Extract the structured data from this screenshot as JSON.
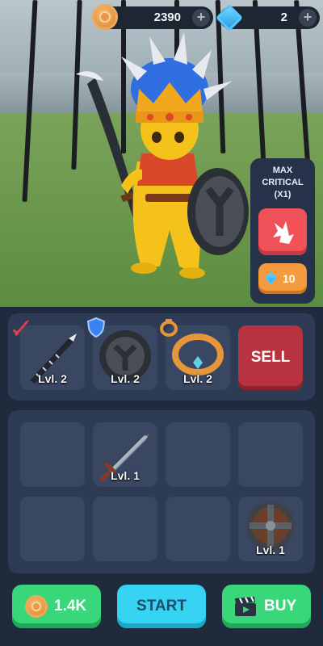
{
  "currency": {
    "coins": "2390",
    "gems": "2",
    "plus": "+"
  },
  "crit_panel": {
    "line1": "MAX",
    "line2": "CRITICAL",
    "line3": "(X1)",
    "cost": "10"
  },
  "equipment": {
    "weapon": {
      "level": "Lvl. 2"
    },
    "shield": {
      "level": "Lvl. 2"
    },
    "ring": {
      "level": "Lvl. 2"
    },
    "sell_label": "SELL"
  },
  "inventory": [
    {
      "slot": 1,
      "item": "",
      "level": ""
    },
    {
      "slot": 2,
      "item": "sword",
      "level": "Lvl. 1"
    },
    {
      "slot": 3,
      "item": "",
      "level": ""
    },
    {
      "slot": 4,
      "item": "",
      "level": ""
    },
    {
      "slot": 5,
      "item": "",
      "level": ""
    },
    {
      "slot": 6,
      "item": "",
      "level": ""
    },
    {
      "slot": 7,
      "item": "",
      "level": ""
    },
    {
      "slot": 8,
      "item": "round-shield",
      "level": "Lvl. 1"
    }
  ],
  "buttons": {
    "coins_label": "1.4K",
    "start_label": "START",
    "buy_label": "BUY"
  },
  "colors": {
    "accent_green": "#38d779",
    "accent_cyan": "#36d3f2",
    "sell_red": "#b8323f",
    "panel": "#2e3b55"
  }
}
